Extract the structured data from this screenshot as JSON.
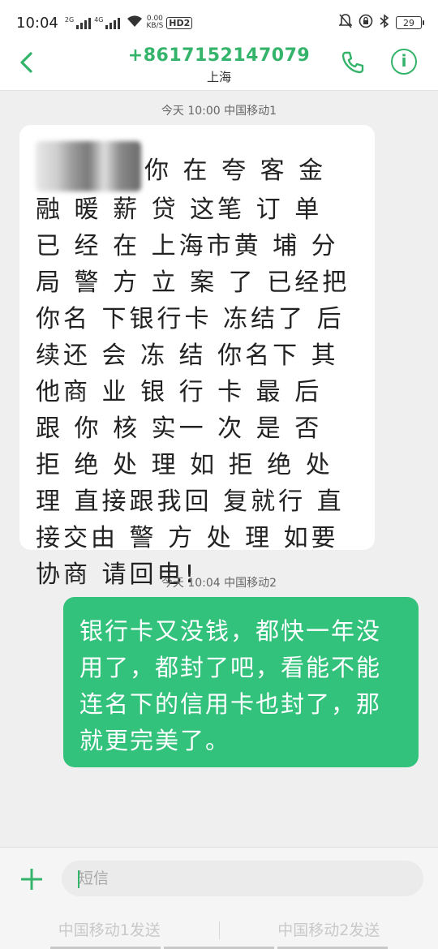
{
  "status_bar": {
    "time": "10:04",
    "net_type_1": "2G",
    "net_type_2": "4G",
    "net_speed_value": "0.00",
    "net_speed_unit": "KB/S",
    "hd_label": "HD2",
    "battery": "29",
    "icons": [
      "wifi-icon",
      "silent-bell-icon",
      "lock-rotation-icon",
      "bluetooth-icon",
      "battery-icon"
    ]
  },
  "header": {
    "number": "+8617152147079",
    "location": "上海",
    "icons": [
      "back-arrow-icon",
      "phone-call-icon",
      "info-icon"
    ]
  },
  "messages": [
    {
      "direction": "incoming",
      "meta": "今天 10:00  中国移动1",
      "text": "你 在 夸 客 金 融 暖 薪  贷 这笔 订 单 已 经 在 上海市黄 埔 分 局 警 方 立  案 了  已经把你名 下银行卡 冻结了 后续还 会 冻 结 你名下  其他商 业 银 行 卡   最 后 跟 你 核 实一 次 是 否 拒 绝 处 理 如 拒  绝 处 理 直接跟我回 复就行  直接交由 警  方 处  理   如要协商 请回电!"
    },
    {
      "direction": "outgoing",
      "meta": "今天 10:04  中国移动2",
      "text": "银行卡又没钱，都快一年没用了，都封了吧，看能不能连名下的信用卡也封了，那就更完美了。"
    }
  ],
  "composer": {
    "placeholder": "短信",
    "send_sim1": "中国移动1发送",
    "send_sim2": "中国移动2发送"
  },
  "colors": {
    "accent": "#34b36a",
    "outgoing_bubble": "#33c27c",
    "incoming_bubble": "#ffffff",
    "background": "#efefef"
  }
}
